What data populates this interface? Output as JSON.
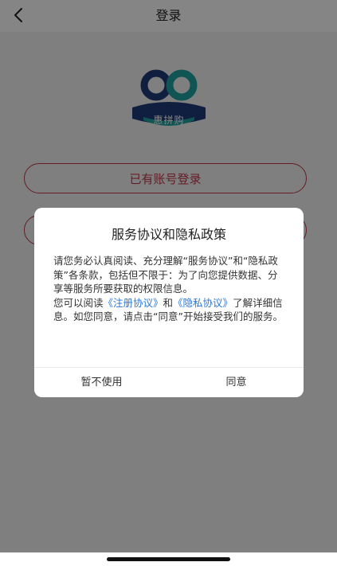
{
  "header": {
    "title": "登录",
    "back_icon": "chevron-left-icon"
  },
  "logo": {
    "text": "惠拼购",
    "colors": {
      "teal": "#1fa3a0",
      "navy": "#1f3b7a"
    }
  },
  "buttons": {
    "login_with_account": "已有账号登录",
    "second_option": ""
  },
  "dialog": {
    "title": "服务协议和隐私政策",
    "para1": "请您务必认真阅读、充分理解“服务协议”和“隐私政策”各条款，包括但不限于：为了向您提供数据、分享等服务所要获取的权限信息。",
    "para2_prefix": "您可以阅读",
    "link_register": "《注册协议》",
    "para2_and": "和",
    "link_privacy": "《隐私协议》",
    "para2_suffix": "了解详细信息。如您同意，请点击“同意”开始接受我们的服务。",
    "decline_label": "暂不使用",
    "agree_label": "同意"
  },
  "colors": {
    "accent": "#c0394b",
    "link": "#2b76d6"
  }
}
